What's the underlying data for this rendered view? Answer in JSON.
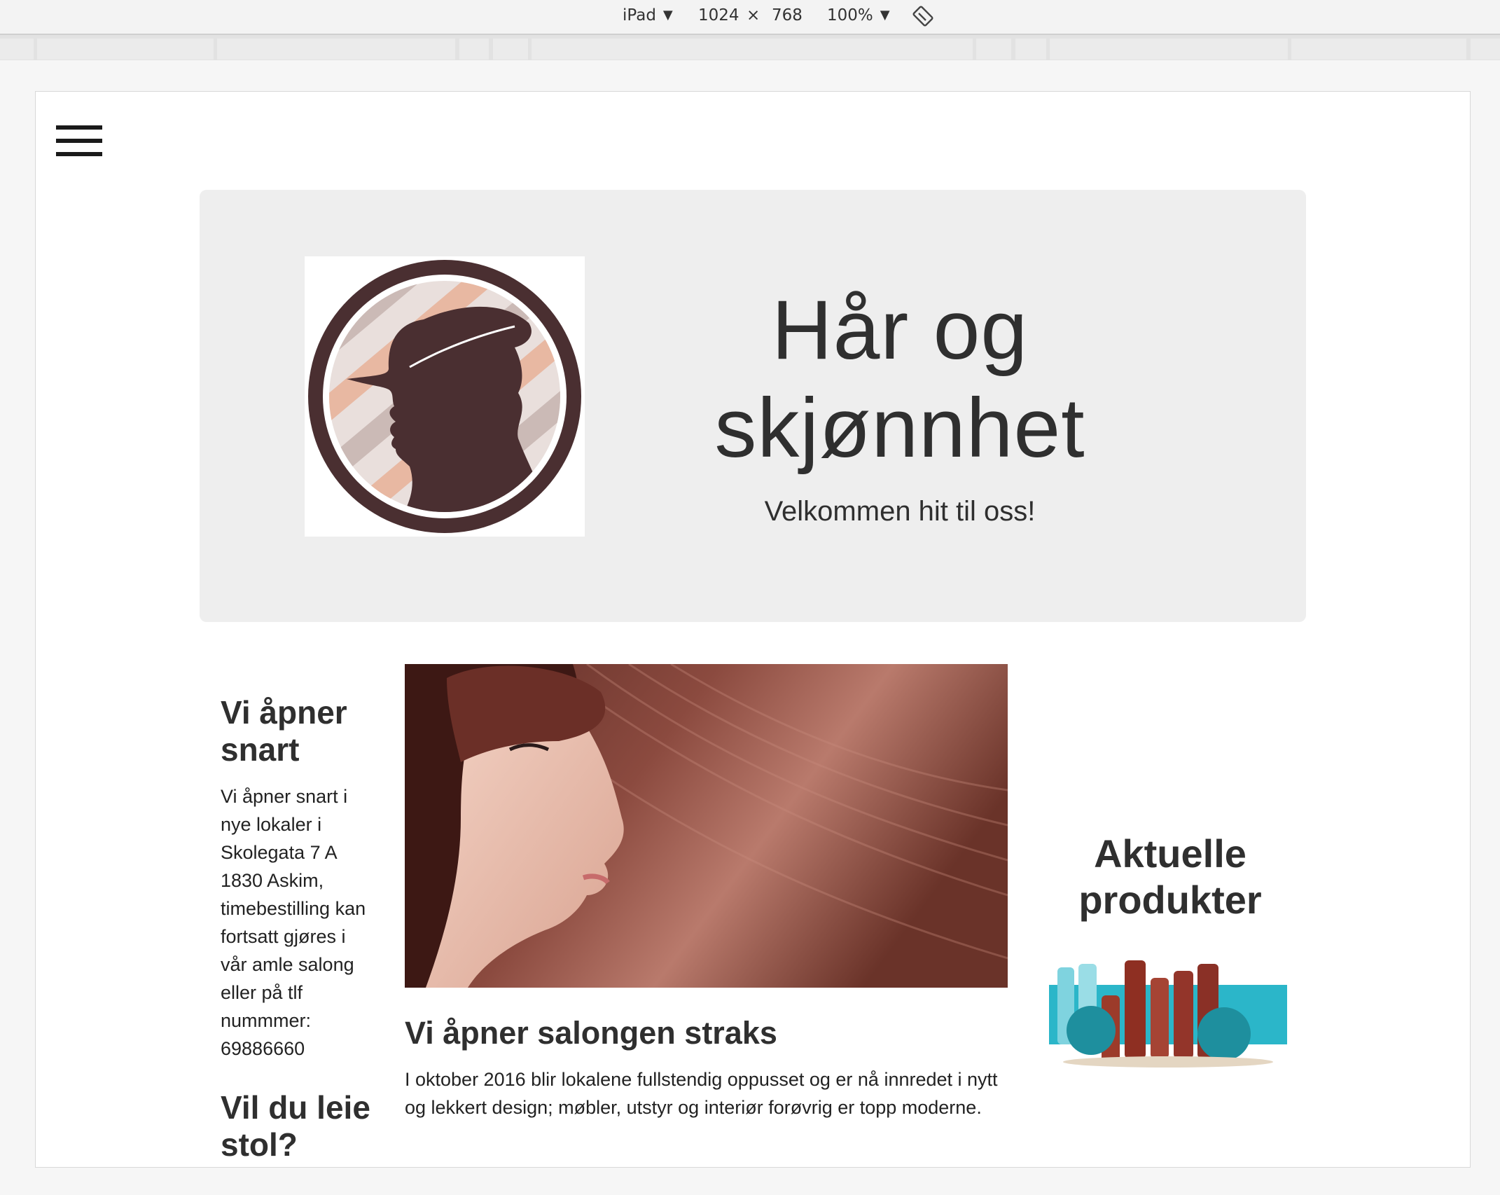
{
  "devtools": {
    "device": "iPad",
    "width": "1024",
    "times": "×",
    "height": "768",
    "zoom": "100%"
  },
  "header": {
    "title_line1": "Hår og",
    "title_line2": "skjønnhet",
    "subtitle": "Velkommen hit til oss!"
  },
  "left_column": {
    "heading1": "Vi åpner snart",
    "text1": "Vi åpner snart i nye lokaler i Skolegata 7 A 1830 Askim, timebestilling kan fortsatt gjøres i vår amle salong eller på tlf nummmer: 69886660",
    "heading2": "Vil du leie stol?"
  },
  "main": {
    "title": "Vi åpner salongen straks",
    "text": "I oktober 2016 blir lokalene fullstendig oppusset og er nå innredet i nytt og lekkert design; møbler, utstyr og interiør forøvrig er topp moderne."
  },
  "right_column": {
    "heading": "Aktuelle produkter"
  },
  "colors": {
    "hero_bg": "#eeeeee",
    "logo_brown": "#4a2f31",
    "logo_peach": "#e8b8a2",
    "product_teal": "#2bb6c9"
  }
}
